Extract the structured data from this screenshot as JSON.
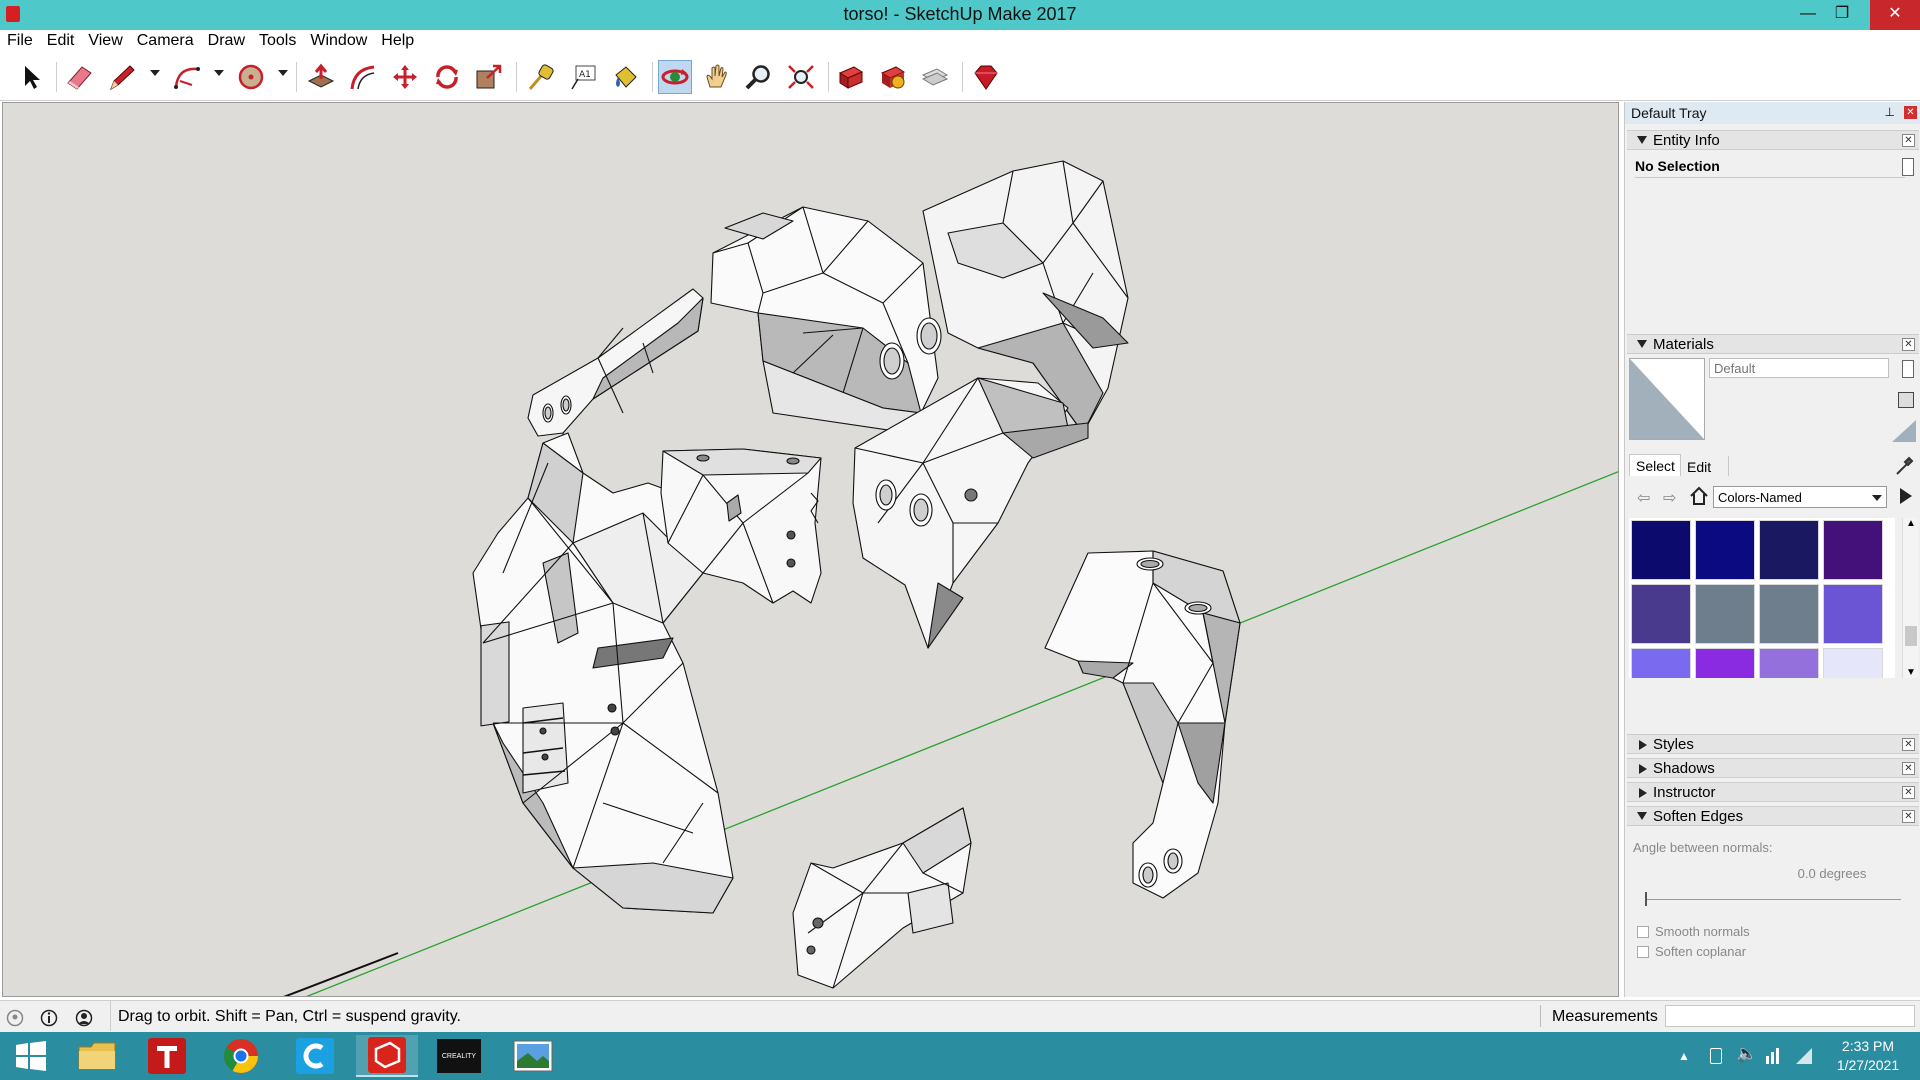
{
  "window": {
    "title": "torso! - SketchUp Make 2017",
    "minimize": "—",
    "maximize": "❐",
    "close": "✕"
  },
  "menu": [
    "File",
    "Edit",
    "View",
    "Camera",
    "Draw",
    "Tools",
    "Window",
    "Help"
  ],
  "toolbar": {
    "tools": [
      {
        "name": "select-tool",
        "icon": "arrow-icon"
      },
      {
        "name": "eraser-tool",
        "icon": "eraser-icon"
      },
      {
        "name": "line-tool",
        "icon": "pencil-icon"
      },
      {
        "name": "arc-tool",
        "icon": "arc-icon"
      },
      {
        "name": "shapes-tool",
        "icon": "circle-icon"
      },
      {
        "name": "push-pull-tool",
        "icon": "push-pull-icon"
      },
      {
        "name": "offset-tool",
        "icon": "offset-icon"
      },
      {
        "name": "move-tool",
        "icon": "move-icon"
      },
      {
        "name": "rotate-tool",
        "icon": "rotate-icon"
      },
      {
        "name": "scale-tool",
        "icon": "scale-icon"
      },
      {
        "name": "tape-measure-tool",
        "icon": "tape-measure-icon"
      },
      {
        "name": "text-tool",
        "icon": "text-icon"
      },
      {
        "name": "paint-bucket-tool",
        "icon": "paint-bucket-icon"
      },
      {
        "name": "orbit-tool",
        "icon": "orbit-icon"
      },
      {
        "name": "pan-tool",
        "icon": "hand-icon"
      },
      {
        "name": "zoom-tool",
        "icon": "magnifier-icon"
      },
      {
        "name": "zoom-extents-tool",
        "icon": "zoom-extents-icon"
      },
      {
        "name": "3d-warehouse-tool",
        "icon": "warehouse-icon"
      },
      {
        "name": "extension-warehouse-tool",
        "icon": "extension-icon"
      },
      {
        "name": "layout-tool",
        "icon": "layout-icon"
      },
      {
        "name": "extension-manager-tool",
        "icon": "ruby-icon"
      }
    ]
  },
  "tray": {
    "title": "Default Tray",
    "entity_info": {
      "label": "Entity Info",
      "selection": "No Selection"
    },
    "materials": {
      "label": "Materials",
      "name_placeholder": "Default",
      "tabs": [
        "Select",
        "Edit"
      ],
      "library": "Colors-Named",
      "swatches": [
        "#0d0a6e",
        "#0c0a80",
        "#1a1860",
        "#44107a",
        "#4a3a8e",
        "#6f7e8c",
        "#6e7e8c",
        "#6c55d4",
        "#7a6af0",
        "#8a2be2",
        "#9370db",
        "#e6e6fa",
        "#ffffff",
        "#d8bfd8",
        "#bc8f8f",
        "#da5fd8"
      ]
    },
    "collapsed_panels": [
      "Styles",
      "Shadows",
      "Instructor"
    ],
    "soften_edges": {
      "label": "Soften Edges",
      "angle_label": "Angle between normals:",
      "angle_value": "0.0  degrees",
      "smooth_label": "Smooth normals",
      "coplanar_label": "Soften coplanar"
    }
  },
  "status": {
    "message": "Drag to orbit. Shift = Pan, Ctrl = suspend gravity.",
    "measurements_label": "Measurements",
    "measurements_value": ""
  },
  "taskbar": {
    "apps": [
      "start-button",
      "file-explorer",
      "t-app",
      "chrome",
      "c-app",
      "sketchup",
      "creality",
      "photos"
    ],
    "creality_label": "CREALITY",
    "time": "2:33 PM",
    "date": "1/27/2021"
  },
  "colors": {
    "accent": "#4ec8c8",
    "taskbar": "#2b8ea0",
    "axis_green": "#2aa02a",
    "viewport": "#dddcd8"
  }
}
